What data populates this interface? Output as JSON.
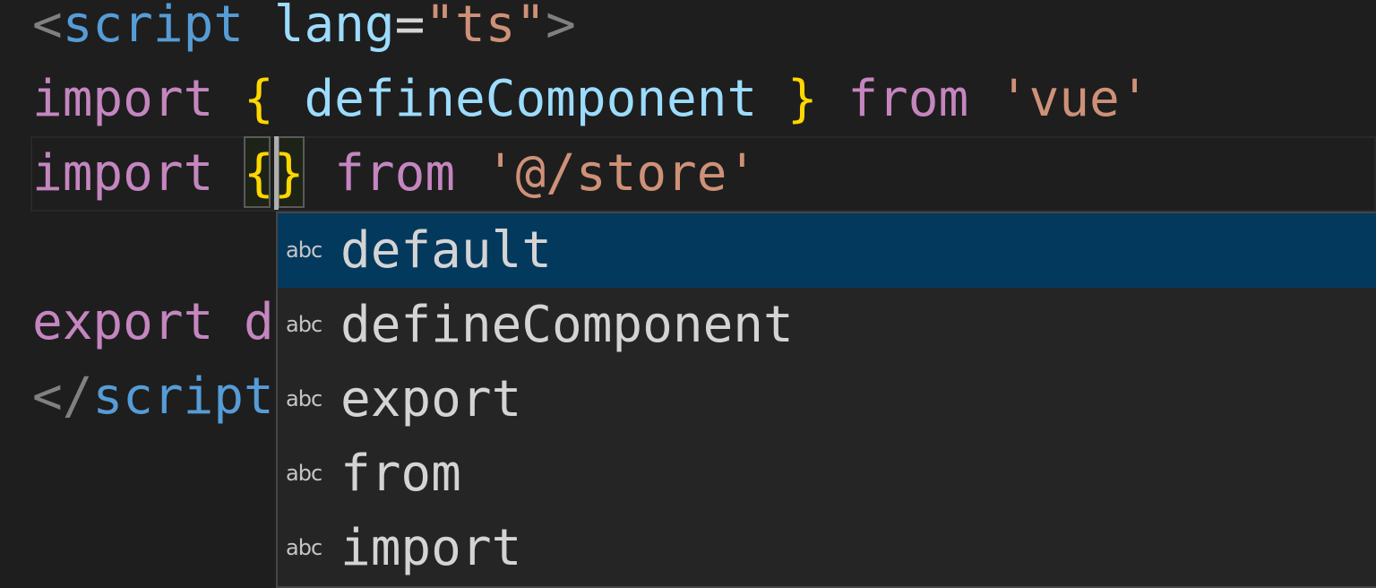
{
  "editor": {
    "lines": [
      {
        "tokens": [
          "<",
          "script",
          " ",
          "lang",
          "=",
          "\"ts\"",
          ">"
        ]
      },
      {
        "tokens": [
          "import",
          " ",
          "{",
          " defineComponent ",
          "}",
          " ",
          "from",
          " ",
          "'vue'"
        ]
      },
      {
        "tokens": [
          "import",
          " ",
          "{",
          "}",
          " ",
          "from",
          " ",
          "'@/store'"
        ]
      },
      {
        "tokens": []
      },
      {
        "tokens": [
          "export",
          " ",
          "d"
        ]
      },
      {
        "tokens": [
          "</",
          "script"
        ]
      }
    ]
  },
  "suggest": {
    "items": [
      {
        "kind": "abc",
        "label": "default",
        "selected": true
      },
      {
        "kind": "abc",
        "label": "defineComponent"
      },
      {
        "kind": "abc",
        "label": "export"
      },
      {
        "kind": "abc",
        "label": "from"
      },
      {
        "kind": "abc",
        "label": "import"
      }
    ]
  },
  "colors": {
    "keyword": "#c586c0",
    "tag": "#569cd6",
    "string": "#ce9178",
    "bracket": "#ffd700",
    "selected": "#04395e"
  }
}
